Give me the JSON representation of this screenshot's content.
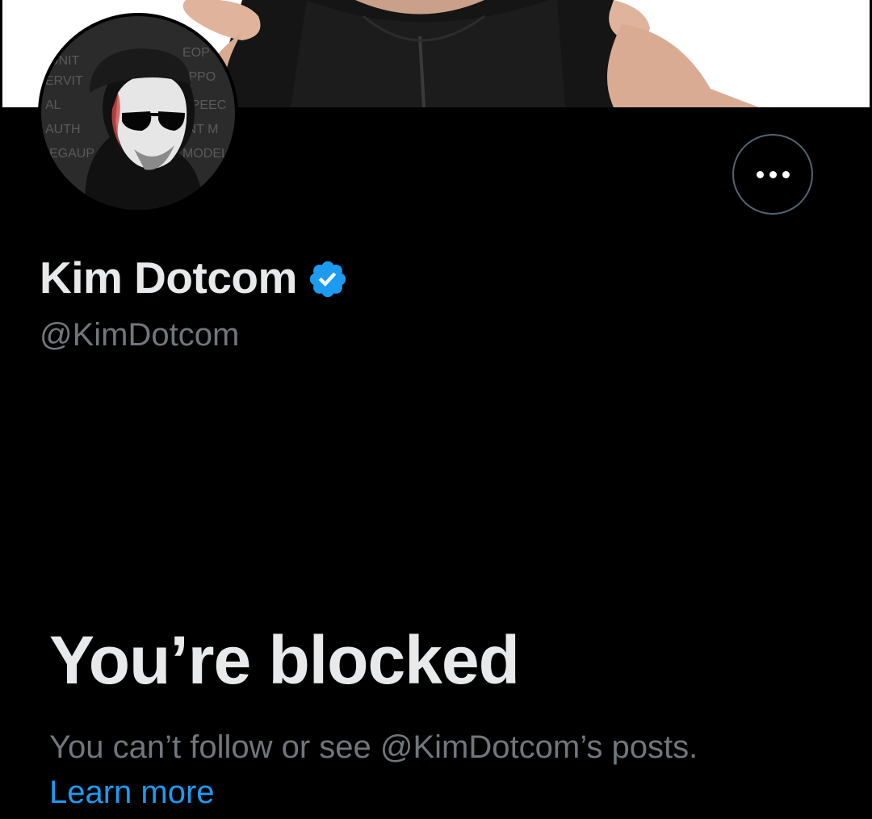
{
  "profile": {
    "display_name": "Kim Dotcom",
    "handle": "@KimDotcom",
    "verified": true,
    "verified_icon": "verified-badge-icon",
    "more_icon": "more-horizontal-icon"
  },
  "blocked": {
    "title": "You’re blocked",
    "message": "You can’t follow or see @KimDotcom’s posts.",
    "learn_more": "Learn more"
  },
  "colors": {
    "background": "#000000",
    "primary_text": "#e7e9ea",
    "secondary_text": "#71767b",
    "link": "#1d9bf0",
    "verified": "#1d9bf0"
  }
}
